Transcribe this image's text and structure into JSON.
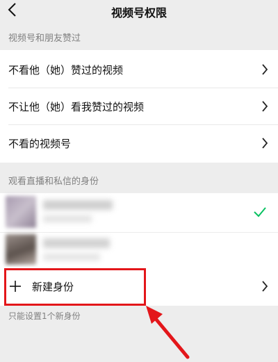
{
  "header": {
    "title": "视频号权限",
    "back_icon": "back-chevron-icon"
  },
  "section1": {
    "label": "视频号和朋友赞过",
    "items": [
      {
        "label": "不看他（她）赞过的视频"
      },
      {
        "label": "不让他（她）看我赞过的视频"
      },
      {
        "label": "不看的视频号"
      }
    ]
  },
  "section2": {
    "label": "观看直播和私信的身份",
    "new_identity_label": "新建身份",
    "hint": "只能设置1个新身份"
  },
  "colors": {
    "accent_check": "#07c160",
    "highlight": "#e3161a"
  }
}
